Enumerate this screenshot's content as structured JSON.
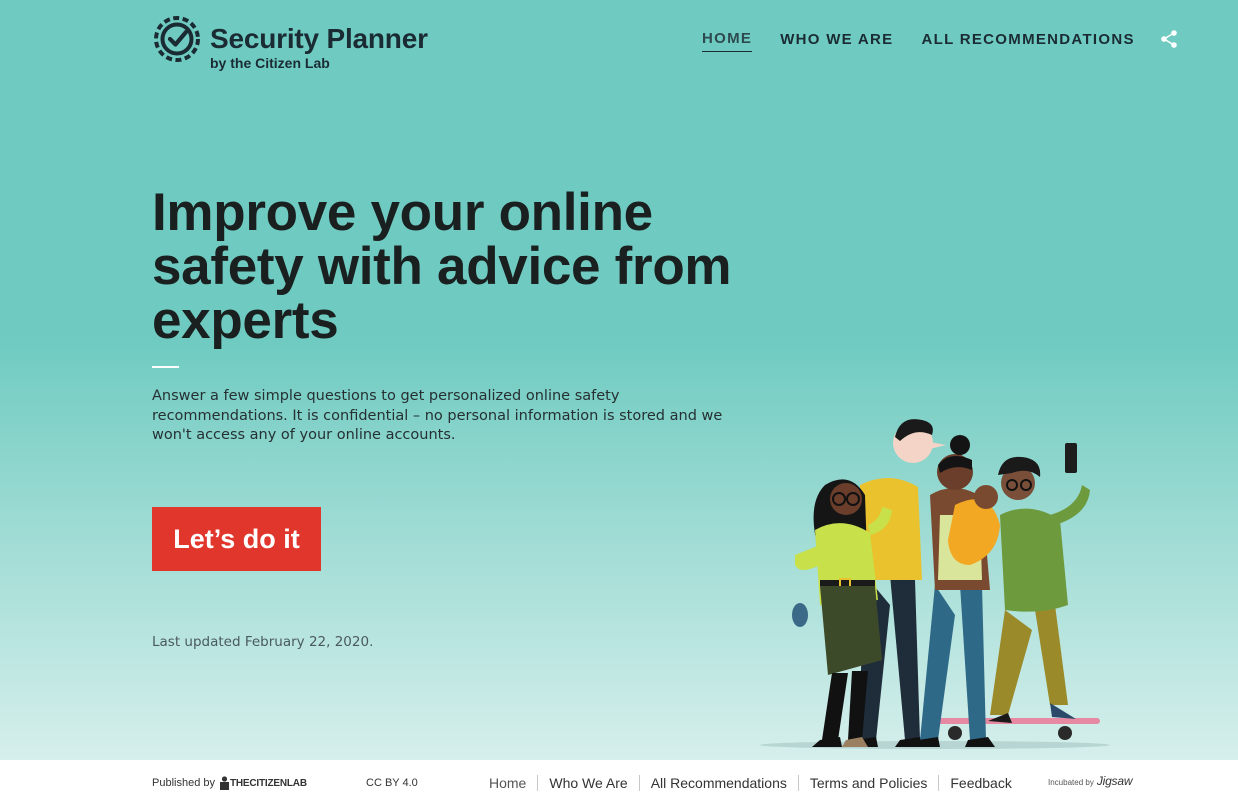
{
  "header": {
    "logo_title": "Security Planner",
    "logo_subtitle": "by the Citizen Lab",
    "nav": [
      {
        "label": "HOME",
        "active": true
      },
      {
        "label": "WHO WE ARE",
        "active": false
      },
      {
        "label": "ALL RECOMMENDATIONS",
        "active": false
      }
    ],
    "share_icon": "share-icon"
  },
  "main": {
    "headline": "Improve your online safety with advice from experts",
    "intro": "Answer a few simple questions to get personalized online safety recommendations. It is confidential – no personal information is stored and we won't access any of your online accounts.",
    "cta_label": "Let’s do it",
    "last_updated": "Last updated February 22, 2020.",
    "illustration_icon": "people-group-illustration"
  },
  "footer": {
    "published_by": "Published by",
    "publisher_name": "THECITIZENLAB",
    "license": "CC BY 4.0",
    "links": [
      "Home",
      "Who We Are",
      "All Recommendations",
      "Terms and Policies",
      "Feedback"
    ],
    "incubated_by": "Incubated by",
    "incubator": "Jigsaw"
  },
  "colors": {
    "hero_bg": "#6fcbc1",
    "cta_bg": "#e1362b",
    "text_dark": "#1b2b33"
  }
}
